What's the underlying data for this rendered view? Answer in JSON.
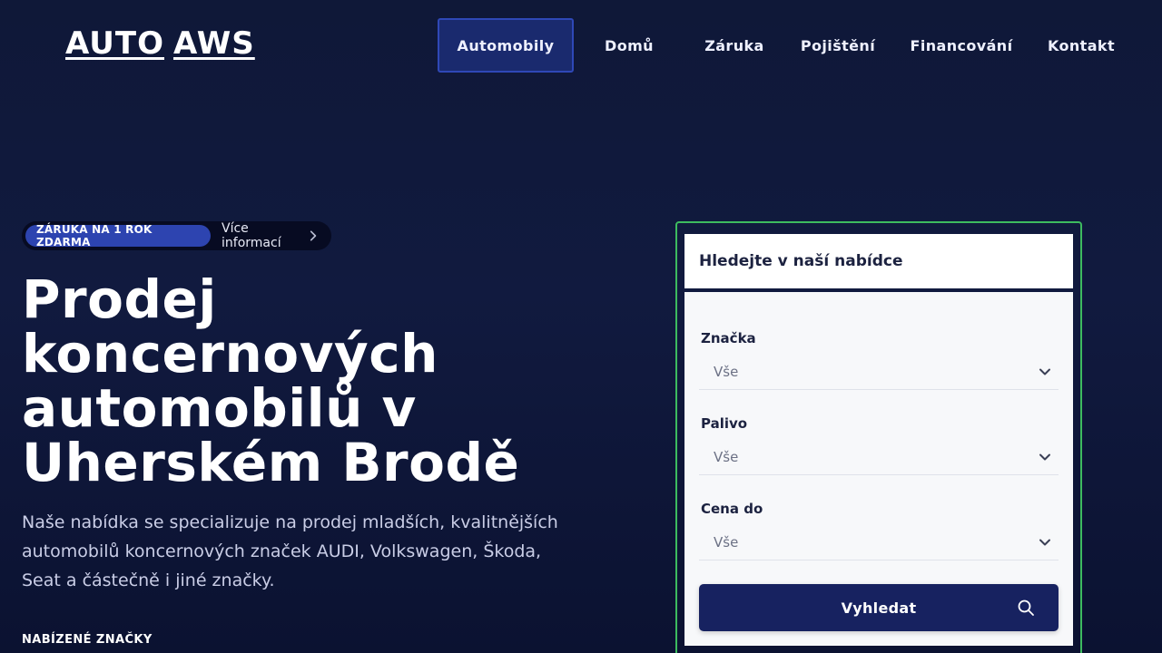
{
  "header": {
    "logo_part1": "AUTO",
    "logo_part2": "AWS",
    "nav": [
      {
        "label": "Automobily",
        "active": true
      },
      {
        "label": "Domů"
      },
      {
        "label": "Záruka"
      },
      {
        "label": "Pojištění"
      },
      {
        "label": "Financování"
      },
      {
        "label": "Kontakt"
      }
    ]
  },
  "hero": {
    "badge_pill": "ZÁRUKA NA 1 ROK ZDARMA",
    "badge_more": "Více informací",
    "title": "Prodej koncernových automobilů v Uherském Brodě",
    "text": "Naše nabídka se specializuje na prodej mladších, kvalitnějších automobilů koncernových značek AUDI, Volkswagen, Škoda, Seat a částečně i jiné značky.",
    "brands_label": "NABÍZENÉ ZNAČKY"
  },
  "search": {
    "title": "Hledejte v naší nabídce",
    "fields": [
      {
        "label": "Značka",
        "value": "Vše"
      },
      {
        "label": "Palivo",
        "value": "Vše"
      },
      {
        "label": "Cena do",
        "value": "Vše"
      }
    ],
    "button_label": "Vyhledat"
  },
  "colors": {
    "background": "#0f1838",
    "accent": "#2d44b0",
    "button": "#172260",
    "card_border": "#3dbb5f"
  },
  "icons": {
    "badge_chevron": "chevron-right-icon",
    "select_chevron": "chevron-down-icon",
    "search": "search-icon"
  }
}
